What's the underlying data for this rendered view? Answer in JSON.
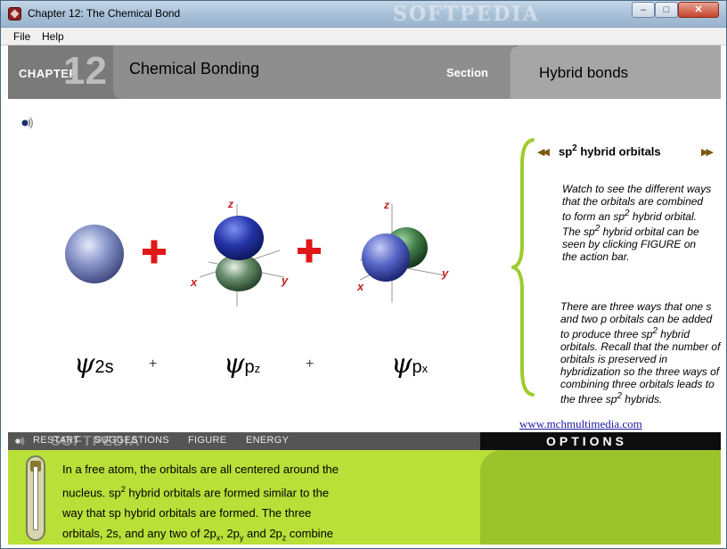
{
  "window": {
    "title": "Chapter 12: The Chemical Bond",
    "watermark": "SOFTPEDIA",
    "controls": {
      "minimize": "–",
      "maximize": "□",
      "close": "✕"
    }
  },
  "menu": {
    "file": "File",
    "help": "Help"
  },
  "header": {
    "chapter_label": "CHAPTER",
    "chapter_number": "12",
    "chapter_title": "Chemical Bonding",
    "section_label": "Section",
    "section_title": "Hybrid bonds"
  },
  "figure": {
    "labels": [
      {
        "psi": "ψ",
        "sub": "2s"
      },
      {
        "psi": "ψ",
        "sub": "p",
        "subsub": "z"
      },
      {
        "psi": "ψ",
        "sub": "p",
        "subsub": "x"
      }
    ],
    "plus": "+",
    "axis_labels": {
      "z": "z",
      "x": "x",
      "y": "y"
    }
  },
  "sidebar": {
    "title_prefix": "sp",
    "title_sup": "2",
    "title_suffix": " hybrid orbitals",
    "para1": [
      "Watch to see the different ways that the orbitals are combined to form an sp",
      "2",
      " hybrid orbital. The sp",
      "2",
      " hybrid orbital can be seen by clicking FIGURE on the action bar."
    ],
    "para2": [
      "There are three ways that one s and two p orbitals can be added to produce three sp",
      "2",
      " hybrid orbitals.  Recall that the number of orbitals is preserved in hybridization so the three ways of combining three orbitals leads to the three sp",
      "2",
      " hybrids."
    ],
    "credit": "www.mchmultimedia.com"
  },
  "nav": {
    "restart": "RESTART",
    "suggestions": "SUGGESTIONS",
    "figure": "FIGURE",
    "energy": "ENERGY",
    "watermark": "SOFTPEDIA"
  },
  "options": {
    "label": "OPTIONS"
  },
  "bottom_text": {
    "line1": "In a free atom, the orbitals are all centered around the",
    "line2a": "nucleus.  sp",
    "line2sup": "2",
    "line2b": " hybrid orbitals are formed similar to the",
    "line3": "way that sp hybrid orbitals are formed.  The three",
    "line4a": "orbitals, 2s, and any two of 2p",
    "sub_x": "x",
    "line4b": ", 2p",
    "sub_y": "y",
    "line4c": " and 2p",
    "sub_z": "z",
    "line4d": " combine"
  },
  "colors": {
    "header_bg": "#6b6b6b",
    "accent_green": "#b8e038",
    "plus_red": "#e01818",
    "brace_green": "#9ccc2c"
  }
}
